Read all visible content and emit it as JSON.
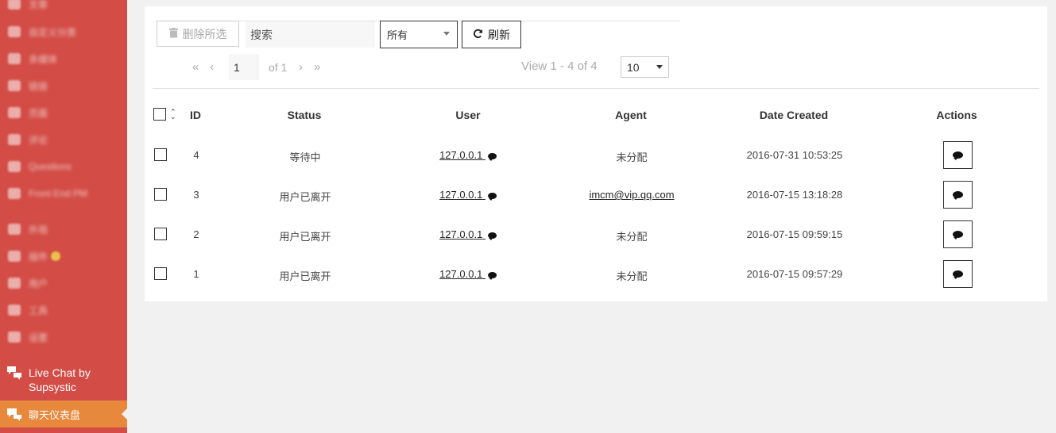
{
  "sidebar": {
    "blurred_items": [
      {
        "label": "文章"
      },
      {
        "label": "自定义分类"
      },
      {
        "label": "多媒体"
      },
      {
        "label": "链接"
      },
      {
        "label": "页面"
      },
      {
        "label": "评论"
      },
      {
        "label": "Questions"
      },
      {
        "label": "Front End PM"
      },
      {
        "label": "外观"
      },
      {
        "label": "插件"
      },
      {
        "label": "用户"
      },
      {
        "label": "工具"
      },
      {
        "label": "设置"
      }
    ],
    "livechat_label": "Live Chat by Supsystic",
    "active_label": "聊天仪表盘"
  },
  "toolbar": {
    "delete_label": "删除所选",
    "search_placeholder": "搜索",
    "status_selected": "所有",
    "refresh_label": "刷新"
  },
  "pager": {
    "first": "«",
    "prev": "‹",
    "next": "›",
    "last": "»",
    "current_page": "1",
    "of_text": "of 1",
    "view_text": "View 1 - 4 of 4",
    "rows_per_page": "10"
  },
  "table": {
    "headers": {
      "id": "ID",
      "status": "Status",
      "user": "User",
      "agent": "Agent",
      "date": "Date Created",
      "actions": "Actions"
    },
    "rows": [
      {
        "id": "4",
        "status": "等待中",
        "user": "127.0.0.1",
        "agent": "未分配",
        "agent_link": false,
        "date": "2016-07-31 10:53:25"
      },
      {
        "id": "3",
        "status": "用户已离开",
        "user": "127.0.0.1",
        "agent": "imcm@vip.qq.com",
        "agent_link": true,
        "date": "2016-07-15 13:18:28"
      },
      {
        "id": "2",
        "status": "用户已离开",
        "user": "127.0.0.1",
        "agent": "未分配",
        "agent_link": false,
        "date": "2016-07-15 09:59:15"
      },
      {
        "id": "1",
        "status": "用户已离开",
        "user": "127.0.0.1",
        "agent": "未分配",
        "agent_link": false,
        "date": "2016-07-15 09:57:29"
      }
    ]
  },
  "colors": {
    "sidebar_bg": "#d34c45",
    "active_bg": "#e8883d",
    "page_bg": "#f1f1f1"
  }
}
